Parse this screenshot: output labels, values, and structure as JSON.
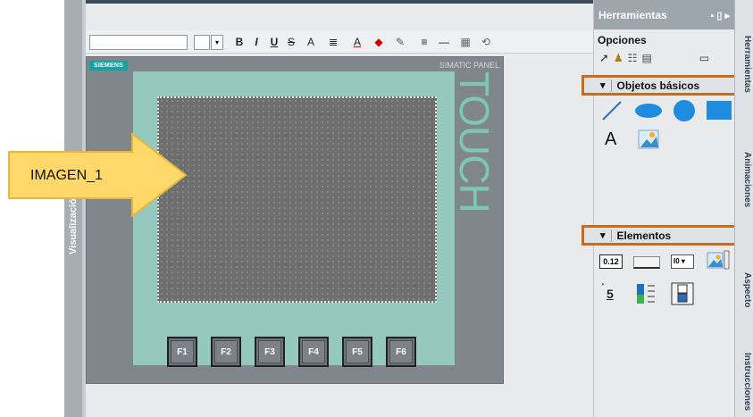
{
  "left_panel": {
    "label": "Visualización"
  },
  "format_toolbar": {
    "buttons": [
      "B",
      "I",
      "U",
      "S",
      "A",
      "A",
      "≡",
      "—"
    ]
  },
  "hmi_panel": {
    "brand": "SIEMENS",
    "model": "SIMATIC PANEL",
    "touch_label": "TOUCH",
    "function_keys": [
      "F1",
      "F2",
      "F3",
      "F4",
      "F5",
      "F6"
    ]
  },
  "callout": {
    "label": "IMAGEN_1",
    "color": "#ffd86a"
  },
  "tools": {
    "title": "Herramientas",
    "options_label": "Opciones",
    "sections": [
      {
        "label": "Objetos básicos"
      },
      {
        "label": "Elementos"
      }
    ],
    "basic_object_text": "A",
    "element_io_text": "0.12",
    "element_dropdown_text": "I0",
    "element_clock_text": "5"
  },
  "side_tabs": [
    "Herramientas",
    "Animaciones",
    "Aspecto",
    "Instrucciones"
  ],
  "colors": {
    "accent_orange": "#c86d1c",
    "siemens_teal": "#14a3a0",
    "bezel": "#96c9bd"
  }
}
